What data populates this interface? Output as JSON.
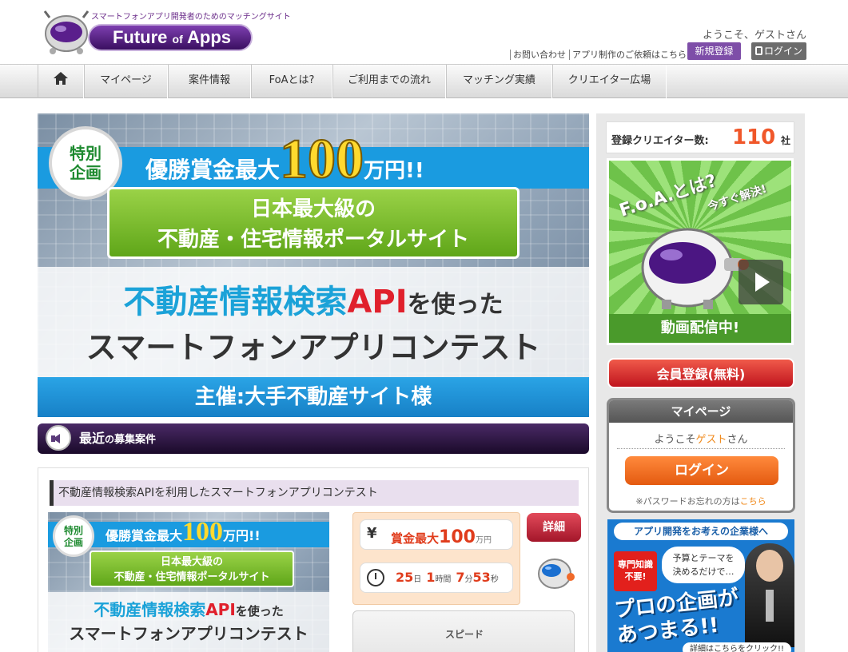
{
  "header": {
    "tagline": "スマートフォンアプリ開発者のためのマッチングサイト",
    "logo_main": "Future",
    "logo_of": "of",
    "logo_end": "Apps",
    "welcome": "ようこそ、ゲストさん",
    "contact_link": "お問い合わせ",
    "request_link": "アプリ制作のご依頼はこちら",
    "register_button": "新規登録",
    "login_button": "ログイン"
  },
  "nav": {
    "items": [
      "マイページ",
      "案件情報",
      "FoAとは?",
      "ご利用までの流れ",
      "マッチング実績",
      "クリエイター広場"
    ]
  },
  "banner": {
    "badge": "特別\n企画",
    "prize_prefix": "優勝賞金最大",
    "prize_amount": "100",
    "prize_unit": "万円!!",
    "green_line1": "日本最大級の",
    "green_line2": "不動産・住宅情報ポータルサイト",
    "api_blue": "不動産情報検索",
    "api_red": "API",
    "api_dark": "を使った",
    "contest": "スマートフォンアプリコンテスト",
    "host": "主催:大手不動産サイト様"
  },
  "section": {
    "title_a": "最近",
    "title_b": "の",
    "title_c": "募集案件"
  },
  "card": {
    "title": "不動産情報検索APIを利用したスマートフォンアプリコンテスト",
    "thumb_badge": "特別\n企画",
    "thumb_prize_prefix": "優勝賞金最大",
    "thumb_prize_amount": "100",
    "thumb_prize_unit": "万円!!",
    "thumb_green1": "日本最大級の",
    "thumb_green2": "不動産・住宅情報ポータルサイト",
    "thumb_api_blue": "不動産情報検索",
    "thumb_api_red": "API",
    "thumb_api_dark": "を使った",
    "thumb_contest": "スマートフォンアプリコンテスト",
    "yen_icon": "¥",
    "prize_label": "賞金最大",
    "prize_value": "100",
    "prize_unit": "万円",
    "days": "25",
    "days_unit": "日",
    "hours": "1",
    "hours_unit": "時間",
    "minutes": "7",
    "minutes_unit": "分",
    "seconds": "53",
    "seconds_unit": "秒",
    "detail_button": "詳細",
    "speed_label": "スピード"
  },
  "sidebar": {
    "creator_label": "登録クリエイター数:",
    "creator_count": "110",
    "creator_unit": "社",
    "video_title": "F.o.A.とは?",
    "video_sub": "今すぐ解決!",
    "video_footer": "動画配信中!",
    "member_button": "会員登録(無料)",
    "mypage_title": "マイページ",
    "mypage_welcome_a": "ようこそ",
    "mypage_welcome_guest": "ゲスト",
    "mypage_welcome_b": "さん",
    "login_button": "ログイン",
    "forgot_a": "※パスワードお忘れの方は",
    "forgot_link": "こちら",
    "ad_head": "アプリ開発をお考えの企業様へ",
    "ad_badge": "専門知識\n不要!",
    "ad_bubble": "予算とテーマを\n決めるだけで…",
    "ad_main_1": "プロの企画が",
    "ad_main_2": "あつまる!!",
    "ad_footer": "詳細はこちらをクリック!!"
  },
  "colors": {
    "brand_purple": "#7e4ea8",
    "accent_orange": "#f0572a",
    "banner_blue": "#1a9be0",
    "red_button": "#c0141e"
  }
}
